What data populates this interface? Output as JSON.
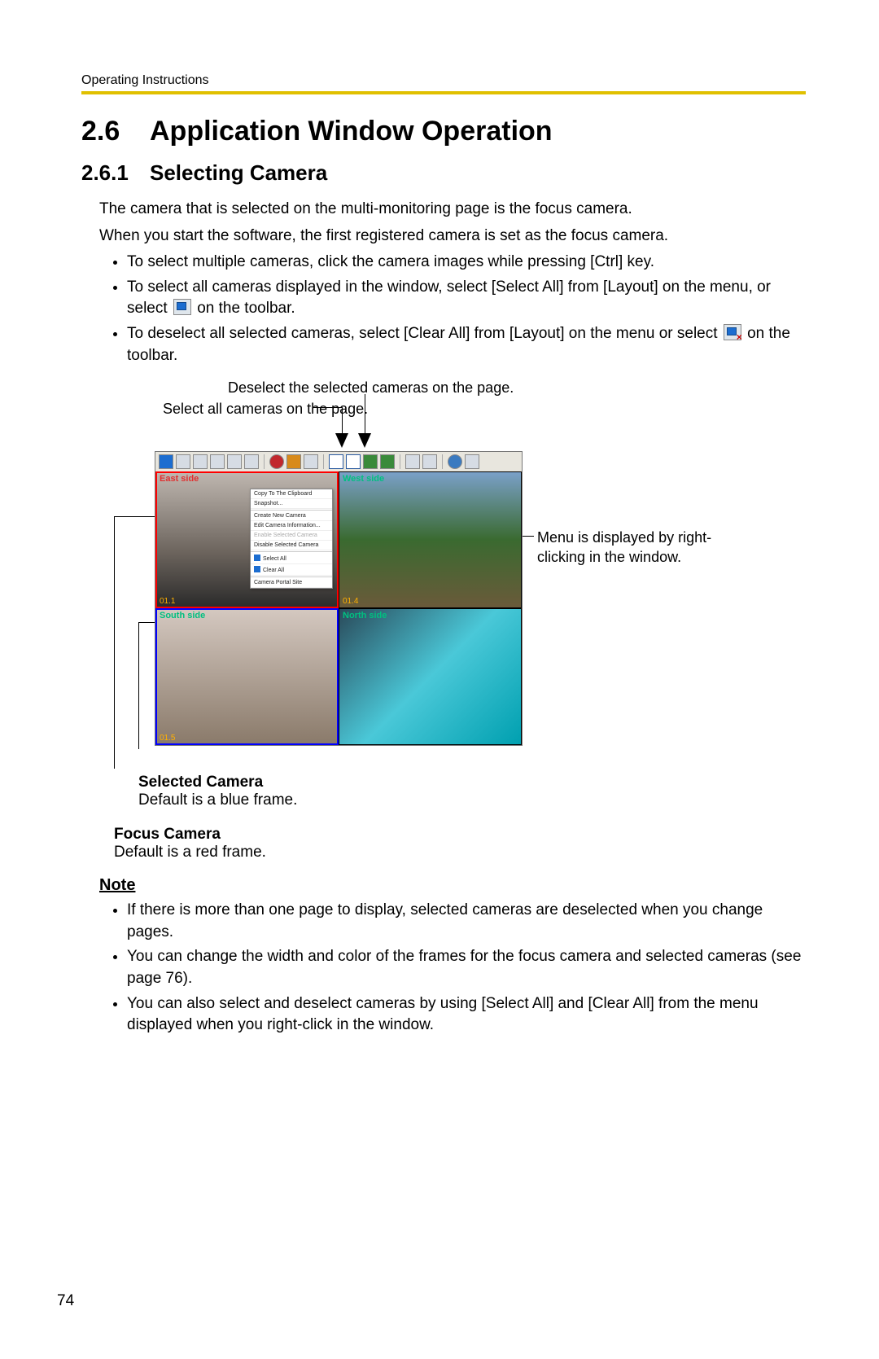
{
  "header": {
    "running": "Operating Instructions"
  },
  "section": {
    "num": "2.6",
    "title": "Application Window Operation",
    "sub_num": "2.6.1",
    "sub_title": "Selecting Camera"
  },
  "intro": {
    "p1": "The camera that is selected on the multi-monitoring page is the focus camera.",
    "p2": "When you start the software, the first registered camera is set as the focus camera."
  },
  "bullets": {
    "b1": "To select multiple cameras, click the camera images while pressing [Ctrl] key.",
    "b2a": "To select all cameras displayed in the window, select [Select All] from [Layout] on the menu, or select ",
    "b2b": " on the toolbar.",
    "b3a": "To deselect all selected cameras, select [Clear All] from [Layout] on the menu or select ",
    "b3b": " on the toolbar."
  },
  "figure": {
    "callout_deselect": "Deselect the selected cameras on the page.",
    "callout_selectall": "Select all cameras on the page.",
    "callout_rightclick": "Menu is displayed by right-clicking in the window.",
    "cameras": {
      "tl": {
        "label": "East side",
        "id": "01.1"
      },
      "tr": {
        "label": "West side",
        "id": "01.4"
      },
      "bl": {
        "label": "South side",
        "id": "01.5"
      },
      "br": {
        "label": "North side",
        "id": ""
      }
    },
    "context_menu": {
      "items": [
        "Copy To The Clipboard",
        "Snapshot...",
        "Create New Camera",
        "Edit Camera Information...",
        "Enable Selected Camera",
        "Disable Selected Camera",
        "Select All",
        "Clear All",
        "Camera Portal Site"
      ]
    }
  },
  "side_labels": {
    "selected_title": "Selected Camera",
    "selected_desc": "Default is a blue frame.",
    "focus_title": "Focus Camera",
    "focus_desc": "Default is a red frame."
  },
  "note": {
    "heading": "Note",
    "n1": "If there is more than one page to display, selected cameras are deselected when you change pages.",
    "n2": "You can change the width and color of the frames for the focus camera and selected cameras (see page 76).",
    "n3": "You can also select and deselect cameras by using [Select All] and [Clear All] from the menu displayed when you right-click in the window."
  },
  "page_number": "74"
}
